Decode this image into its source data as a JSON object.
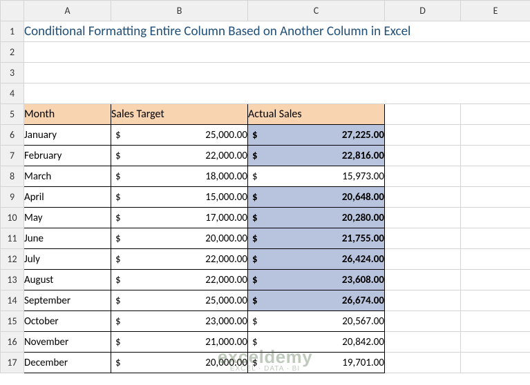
{
  "columns": [
    "A",
    "B",
    "C",
    "D",
    "E"
  ],
  "title": "Conditional Formatting Entire Column Based on Another Column in Excel",
  "headers": {
    "month": "Month",
    "target": "Sales Target",
    "actual": "Actual Sales"
  },
  "currency": "$",
  "rows": [
    {
      "n": 6,
      "month": "January",
      "target": "25,000.00",
      "actual": "27,225.00",
      "hl": true
    },
    {
      "n": 7,
      "month": "February",
      "target": "22,000.00",
      "actual": "22,816.00",
      "hl": true
    },
    {
      "n": 8,
      "month": "March",
      "target": "18,000.00",
      "actual": "15,973.00",
      "hl": false
    },
    {
      "n": 9,
      "month": "April",
      "target": "15,000.00",
      "actual": "20,648.00",
      "hl": true
    },
    {
      "n": 10,
      "month": "May",
      "target": "17,000.00",
      "actual": "20,280.00",
      "hl": true
    },
    {
      "n": 11,
      "month": "June",
      "target": "20,000.00",
      "actual": "21,755.00",
      "hl": true
    },
    {
      "n": 12,
      "month": "July",
      "target": "22,000.00",
      "actual": "26,424.00",
      "hl": true
    },
    {
      "n": 13,
      "month": "August",
      "target": "22,000.00",
      "actual": "23,608.00",
      "hl": true
    },
    {
      "n": 14,
      "month": "September",
      "target": "25,000.00",
      "actual": "26,674.00",
      "hl": true
    },
    {
      "n": 15,
      "month": "October",
      "target": "23,000.00",
      "actual": "20,567.00",
      "hl": false
    },
    {
      "n": 16,
      "month": "November",
      "target": "21,000.00",
      "actual": "20,842.00",
      "hl": false
    },
    {
      "n": 17,
      "month": "December",
      "target": "20,000.00",
      "actual": "19,701.00",
      "hl": false
    }
  ],
  "watermark": {
    "main": "exceldemy",
    "sub": "EXCEL · DATA · BI"
  },
  "chart_data": {
    "type": "table",
    "title": "Conditional Formatting Entire Column Based on Another Column in Excel",
    "categories": [
      "January",
      "February",
      "March",
      "April",
      "May",
      "June",
      "July",
      "August",
      "September",
      "October",
      "November",
      "December"
    ],
    "series": [
      {
        "name": "Sales Target",
        "values": [
          25000,
          22000,
          18000,
          15000,
          17000,
          20000,
          22000,
          22000,
          25000,
          23000,
          21000,
          20000
        ]
      },
      {
        "name": "Actual Sales",
        "values": [
          27225,
          22816,
          15973,
          20648,
          20280,
          21755,
          26424,
          23608,
          26674,
          20567,
          20842,
          19701
        ]
      }
    ],
    "note": "Actual Sales cells highlighted when Actual >= Target"
  }
}
